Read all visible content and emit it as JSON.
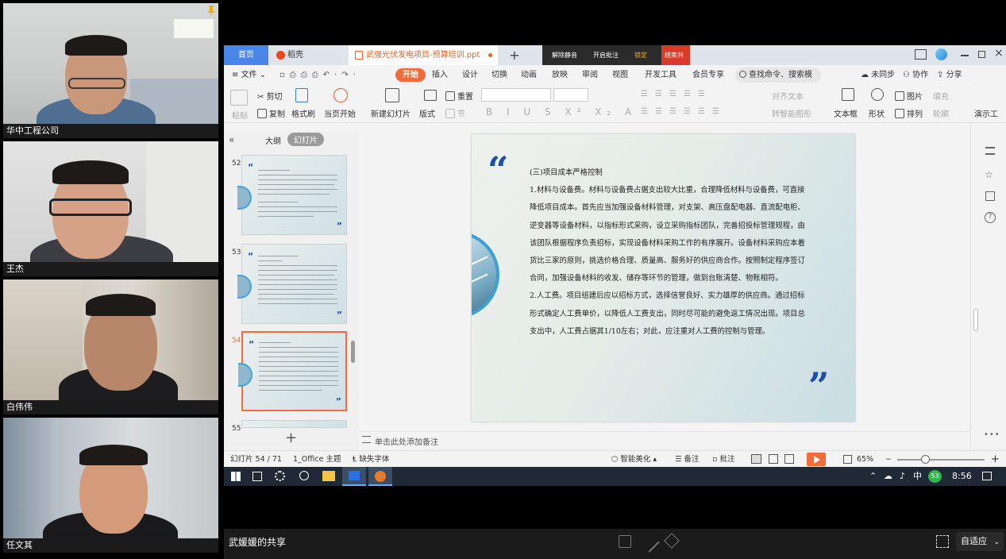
{
  "participants": [
    {
      "name": "华中工程公司",
      "pinned": true
    },
    {
      "name": "王杰"
    },
    {
      "name": "白伟伟"
    },
    {
      "name": "任文其"
    }
  ],
  "window": {
    "tabs": [
      "首页",
      "稻壳",
      "武强光伏发电项目-预算培训.ppt"
    ],
    "new_tab": "+",
    "share_controls": [
      "解除静音",
      "开启批注",
      "锁定",
      "结束共享"
    ]
  },
  "menubar": {
    "file": "文件",
    "tabs": [
      "开始",
      "插入",
      "设计",
      "切换",
      "动画",
      "放映",
      "审阅",
      "视图",
      "开发工具",
      "会员专享"
    ],
    "active_tab": "开始",
    "search_placeholder": "查找命令、搜索模板",
    "right": [
      "未同步",
      "协作",
      "分享"
    ]
  },
  "ribbon": {
    "paste": "粘贴",
    "cut": "剪切",
    "copy": "复制",
    "format_painter": "格式刷",
    "play_from_current": "当页开始",
    "new_slide": "新建幻灯片",
    "layout": "版式",
    "section": "节",
    "reset": "重置",
    "align_text": "对齐文本",
    "convert_shape": "转智能图形",
    "textbox": "文本框",
    "shape": "形状",
    "picture": "图片",
    "arrange": "排列",
    "fill": "填充",
    "outline": "轮廓",
    "demo": "演示工"
  },
  "panel": {
    "outline_tab": "大纲",
    "slides_tab": "幻灯片",
    "slide_numbers": [
      "52",
      "53",
      "54",
      "55"
    ],
    "add": "+"
  },
  "slide": {
    "heading": "(三)项目成本严格控制",
    "paragraphs": [
      "1.材料与设备费。材料与设备费占据支出较大比重，合理降低材料与设备费，可直接降低项目成本。首先应当加强设备材料管理，对支架、高压盘配电器、直流配电柜、逆变器等设备材料，以指标形式采购，设立采购指标团队，完善招投标管理规程，由该团队根据程序负责招标，实现设备材料采购工作的有序展开。设备材料采购应本着货比三家的原则，挑选价格合理、质量高、服务好的供应商合作。按照制定程序签订合同，加强设备材料的收发、储存等环节的管理，做到台账清楚、物账相符。",
      "2.人工费。项目组建后应以招标方式，选择信誉良好、实力雄厚的供应商。通过招标形式确定人工费单价，以降低人工费支出，同时尽可能的避免返工情况出现。项目总支出中，人工费占据其1/10左右；对此，应注重对人工费的控制与管理。"
    ]
  },
  "notes_placeholder": "单击此处添加备注",
  "status": {
    "slide_counter": "幻灯片 54 / 71",
    "theme": "1_Office 主题",
    "missing_font": "缺失字体",
    "beautify": "智能美化",
    "notes": "备注",
    "comments": "批注",
    "zoom": "65%"
  },
  "taskbar": {
    "ime": "中",
    "badge": "53",
    "time": "8:56"
  },
  "bottombar": {
    "label": "武媛媛的共享",
    "fit": "自适应"
  }
}
